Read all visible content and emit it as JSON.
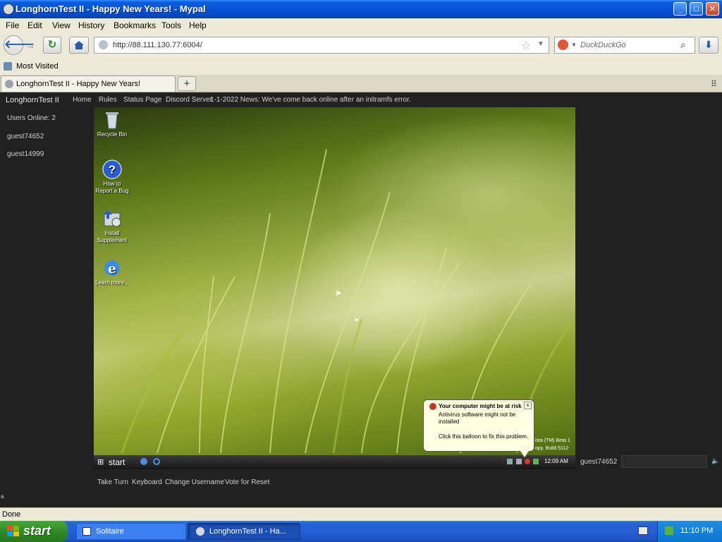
{
  "window": {
    "title": "LonghornTest II - Happy New Years! - Mypal",
    "minimize_label": "_",
    "maximize_label": "□",
    "close_label": "✕"
  },
  "menu": [
    "File",
    "Edit",
    "View",
    "History",
    "Bookmarks",
    "Tools",
    "Help"
  ],
  "nav": {
    "url": "http://88.111.130.77:6004/",
    "search_placeholder": "DuckDuckGo"
  },
  "bookmarks": {
    "most_visited": "Most Visited"
  },
  "tab": {
    "title": "LonghornTest II - Happy New Years!",
    "new_tab_label": "+"
  },
  "site": {
    "brand": "LonghornTest II",
    "nav": [
      "Home",
      "Rules",
      "Status Page",
      "Discord Server"
    ],
    "news": "1-1-2022 News: We've come back online after an initramfs error.",
    "users_online": "Users Online: 2",
    "users": [
      "guest74652",
      "guest14999"
    ],
    "chat_username": "guest74652",
    "actions": [
      "Take Turn",
      "Keyboard",
      "Change Username",
      "Vote for Reset"
    ],
    "sidebar_footer": "a"
  },
  "vm": {
    "desktop_icons": [
      {
        "label": "Recycle Bin"
      },
      {
        "label": "How to Report a Bug"
      },
      {
        "label": "Install Supplement"
      },
      {
        "label": "Learn more..."
      }
    ],
    "start_label": "start",
    "clock": "12:09 AM",
    "watermark_line1": "ista (TM) Beta 1",
    "watermark_line2": "opy. Build 5112",
    "balloon": {
      "title": "Your computer might be at risk",
      "line1": "Antivirus software might not be",
      "line2": "installed",
      "line3": "Click this balloon to fix this problem.",
      "close": "x"
    }
  },
  "status": {
    "text": "Done"
  },
  "taskbar": {
    "start_label": "start",
    "buttons": [
      "Solitaire",
      "LonghornTest II - Ha..."
    ],
    "clock": "11:10 PM"
  }
}
